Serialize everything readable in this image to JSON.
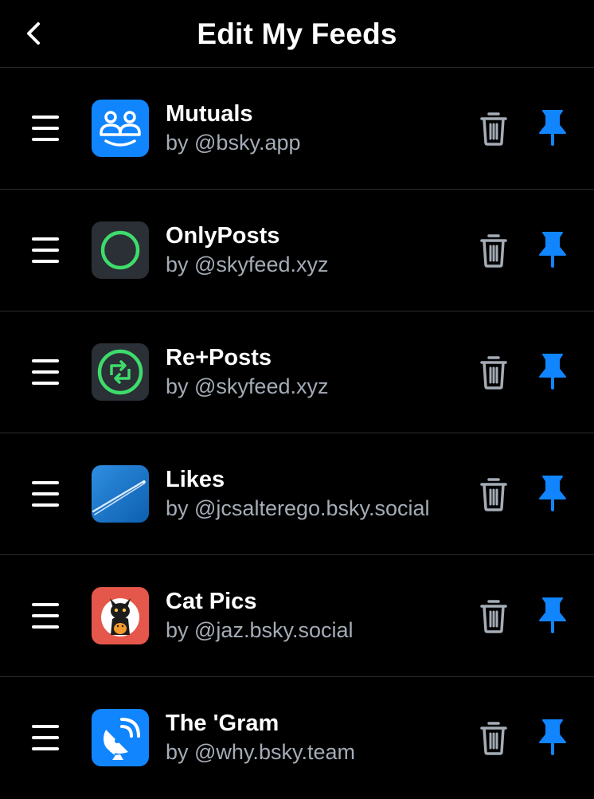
{
  "header": {
    "title": "Edit My Feeds"
  },
  "feeds": [
    {
      "name": "Mutuals",
      "creator": "by @bsky.app",
      "avatar": "mutuals-people-icon"
    },
    {
      "name": "OnlyPosts",
      "creator": "by @skyfeed.xyz",
      "avatar": "green-ring-icon"
    },
    {
      "name": "Re+Posts",
      "creator": "by @skyfeed.xyz",
      "avatar": "repost-circle-icon"
    },
    {
      "name": "Likes",
      "creator": "by @jcsalterego.bsky.social",
      "avatar": "airplane-contrail-image"
    },
    {
      "name": "Cat Pics",
      "creator": "by @jaz.bsky.social",
      "avatar": "cat-pic-image"
    },
    {
      "name": "The 'Gram",
      "creator": "by @why.bsky.team",
      "avatar": "satellite-dish-icon"
    }
  ],
  "colors": {
    "background": "#000000",
    "divider": "#2a2e33",
    "creator_text": "#a4acb6",
    "trash": "#a4acb6",
    "pin": "#1185fe",
    "bsky_blue": "#1185fe"
  }
}
